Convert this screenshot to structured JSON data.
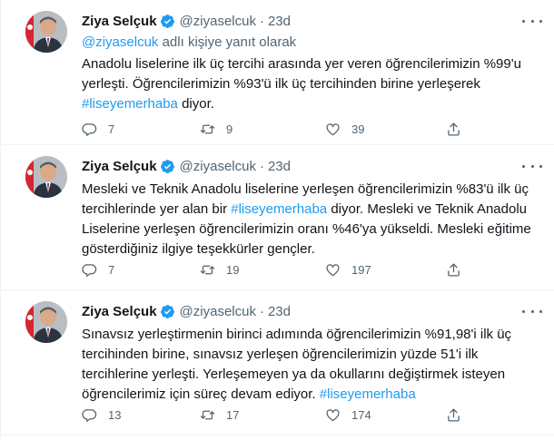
{
  "colors": {
    "accent": "#1d9bf0",
    "secondary_text": "#536471",
    "divider": "#eff3f4"
  },
  "tweets": [
    {
      "author": "Ziya Selçuk",
      "handle": "@ziyaselcuk",
      "separator": "·",
      "time": "23d",
      "reply_to_handle": "@ziyaselcuk",
      "reply_to_suffix": " adlı kişiye yanıt olarak",
      "text_a": "Anadolu liselerine ilk üç tercihi arasında yer veren öğrencilerimizin %99'u yerleşti. Öğrencilerimizin %93'ü ilk üç tercihinden birine yerleşerek ",
      "hashtag": "#liseyemerhaba",
      "text_b": " diyor.",
      "replies": "7",
      "retweets": "9",
      "likes": "39"
    },
    {
      "author": "Ziya Selçuk",
      "handle": "@ziyaselcuk",
      "separator": "·",
      "time": "23d",
      "text_a": "Mesleki ve Teknik Anadolu liselerine yerleşen öğrencilerimizin %83'ü ilk üç tercihlerinde yer alan bir ",
      "hashtag": "#liseyemerhaba",
      "text_b": " diyor. Mesleki ve Teknik Anadolu Liselerine yerleşen öğrencilerimizin oranı %46'ya yükseldi. Mesleki eğitime gösterdiğiniz ilgiye teşekkürler gençler.",
      "replies": "7",
      "retweets": "19",
      "likes": "197"
    },
    {
      "author": "Ziya Selçuk",
      "handle": "@ziyaselcuk",
      "separator": "·",
      "time": "23d",
      "text_a": "Sınavsız yerleştirmenin birinci adımında öğrencilerimizin %91,98'i ilk üç tercihinden birine, sınavsız yerleşen öğrencilerimizin yüzde 51'i ilk tercihlerine yerleşti. Yerleşemeyen ya da okullarını değiştirmek isteyen öğrencilerimiz için süreç devam ediyor. ",
      "hashtag": "#liseyemerhaba",
      "text_b": "",
      "replies": "13",
      "retweets": "17",
      "likes": "174"
    }
  ],
  "icons": [
    "avatar",
    "verified-badge-icon",
    "more-options-icon",
    "reply-icon",
    "retweet-icon",
    "like-icon",
    "share-icon"
  ]
}
